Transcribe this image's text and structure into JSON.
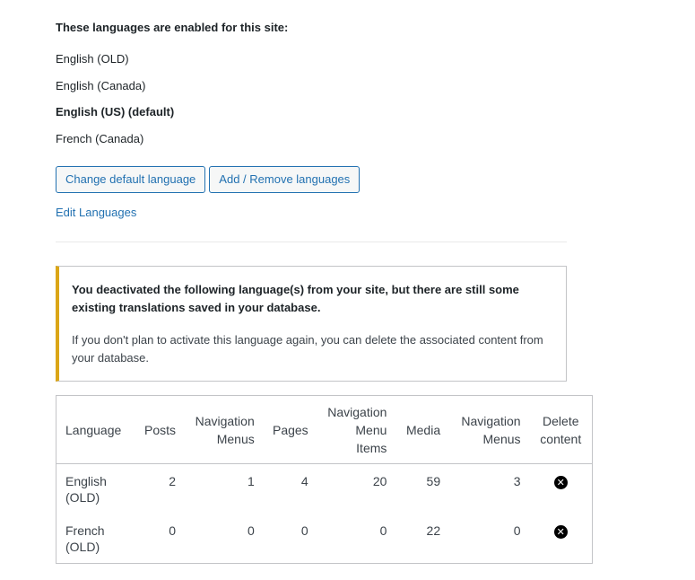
{
  "heading": "These languages are enabled for this site:",
  "languages": [
    {
      "label": "English (OLD)"
    },
    {
      "label": "English (Canada)"
    },
    {
      "label": "English (US) (default)"
    },
    {
      "label": "French (Canada)"
    }
  ],
  "buttons": {
    "change_default": "Change default language",
    "add_remove": "Add / Remove languages"
  },
  "edit_link": "Edit Languages",
  "notice": {
    "title": "You deactivated the following language(s) from your site, but there are still some existing translations saved in your database.",
    "body": "If you don't plan to activate this language again, you can delete the associated content from your database."
  },
  "table": {
    "headers": [
      "Language",
      "Posts",
      "Navigation Menus",
      "Pages",
      "Navigation Menu Items",
      "Media",
      "Navigation Menus",
      "Delete content"
    ],
    "rows": [
      {
        "language": "English (OLD)",
        "posts": "2",
        "nav_menus": "1",
        "pages": "4",
        "nav_menu_items": "20",
        "media": "59",
        "nav_menus_2": "3",
        "delete_icon": "close-circle-icon"
      },
      {
        "language": "French (OLD)",
        "posts": "0",
        "nav_menus": "0",
        "pages": "0",
        "nav_menu_items": "0",
        "media": "22",
        "nav_menus_2": "0",
        "delete_icon": "close-circle-icon"
      }
    ]
  },
  "colors": {
    "link": "#2271b1",
    "notice_accent": "#dba617",
    "border": "#c3c4c7"
  }
}
